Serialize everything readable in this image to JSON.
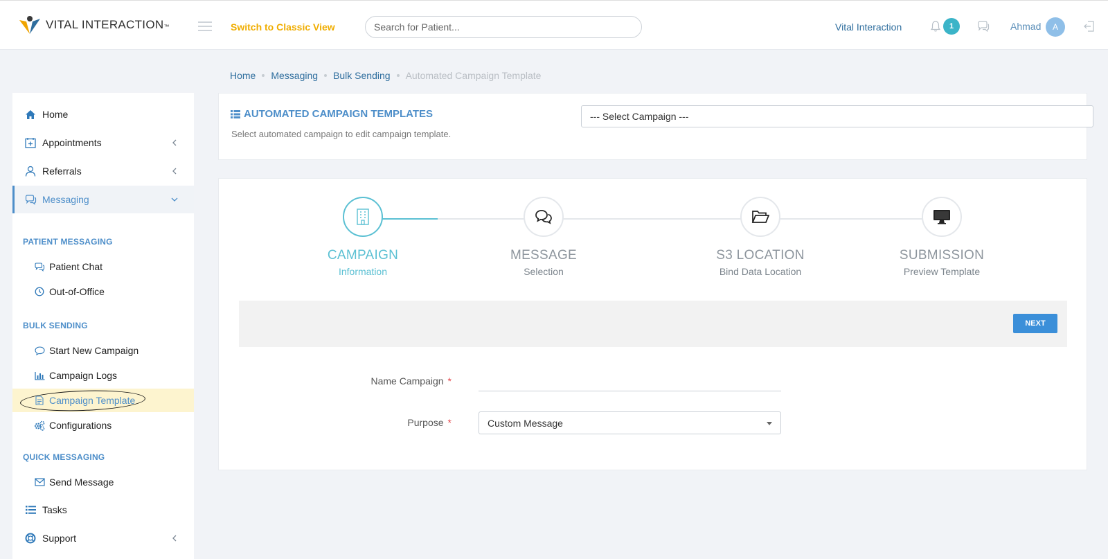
{
  "header": {
    "brand_light": "VITAL",
    "brand_bold": "INTERACTION",
    "brand_tm": "™",
    "classic_view": "Switch to Classic View",
    "search_placeholder": "Search for Patient...",
    "org_name": "Vital Interaction",
    "notification_count": "1",
    "user_name": "Ahmad",
    "avatar_initial": "A"
  },
  "breadcrumb": [
    "Home",
    "Messaging",
    "Bulk Sending",
    "Automated Campaign Template"
  ],
  "sidebar": {
    "items": [
      {
        "label": "Home",
        "icon": "home-icon"
      },
      {
        "label": "Appointments",
        "icon": "calendar-plus-icon"
      },
      {
        "label": "Referrals",
        "icon": "user-icon"
      },
      {
        "label": "Messaging",
        "icon": "chat-icon"
      }
    ],
    "patient_messaging_label": "PATIENT MESSAGING",
    "patient_messaging": [
      {
        "label": "Patient Chat",
        "icon": "chat-icon"
      },
      {
        "label": "Out-of-Office",
        "icon": "clock-icon"
      }
    ],
    "bulk_sending_label": "BULK SENDING",
    "bulk_sending": [
      {
        "label": "Start New Campaign",
        "icon": "comment-icon"
      },
      {
        "label": "Campaign Logs",
        "icon": "bar-chart-icon"
      },
      {
        "label": "Campaign Template",
        "icon": "document-icon"
      },
      {
        "label": "Configurations",
        "icon": "gears-icon"
      }
    ],
    "quick_messaging_label": "QUICK MESSAGING",
    "quick_messaging": [
      {
        "label": "Send Message",
        "icon": "envelope-icon"
      }
    ],
    "bottom_items": [
      {
        "label": "Tasks",
        "icon": "list-icon"
      },
      {
        "label": "Support",
        "icon": "lifebuoy-icon"
      }
    ]
  },
  "campaign_header": {
    "title": "AUTOMATED CAMPAIGN TEMPLATES",
    "subtitle": "Select automated campaign to edit campaign template.",
    "select_value": "--- Select Campaign ---"
  },
  "wizard": {
    "steps": [
      {
        "title": "CAMPAIGN",
        "subtitle": "Information",
        "icon": "building-icon"
      },
      {
        "title": "MESSAGE",
        "subtitle": "Selection",
        "icon": "comments-icon"
      },
      {
        "title": "S3 LOCATION",
        "subtitle": "Bind Data Location",
        "icon": "folder-open-icon"
      },
      {
        "title": "SUBMISSION",
        "subtitle": "Preview Template",
        "icon": "monitor-icon"
      }
    ],
    "next_label": "NEXT"
  },
  "form": {
    "name_label": "Name Campaign",
    "name_value": "",
    "purpose_label": "Purpose",
    "purpose_value": "Custom Message",
    "required_mark": "*"
  },
  "colors": {
    "accent": "#4d8ec9",
    "teal": "#5bc0d3",
    "brand_yellow": "#f0ad00",
    "next_button": "#3b8fd9"
  }
}
